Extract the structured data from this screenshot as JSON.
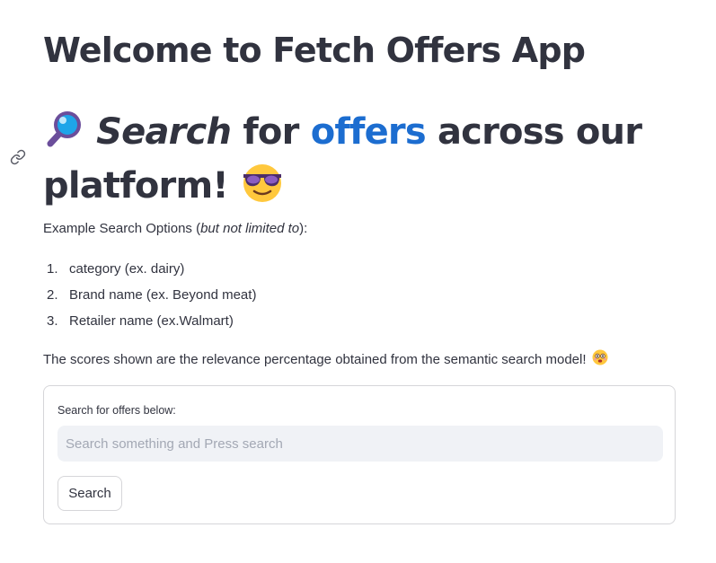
{
  "app_title": "Welcome to Fetch Offers App",
  "headline": {
    "word_search": "Search",
    "word_for": "for",
    "word_offers": "offers",
    "rest_line": "across our",
    "line2": "platform!",
    "accent_color": "#1c6dd0"
  },
  "intro": {
    "prefix": "Example Search Options (",
    "emphasis": "but not limited to",
    "suffix": "):"
  },
  "options": [
    {
      "num": "1.",
      "label": "category (ex. dairy)"
    },
    {
      "num": "2.",
      "label": "Brand name (ex. Beyond meat)"
    },
    {
      "num": "3.",
      "label": "Retailer name (ex.Walmart)"
    }
  ],
  "scores_note": "The scores shown are the relevance percentage obtained from the semantic search model!",
  "form": {
    "label": "Search for offers below:",
    "placeholder": "Search something and Press search",
    "button": "Search"
  },
  "icons": [
    "link-icon",
    "magnifying-glass-icon",
    "sunglasses-face-icon",
    "flushed-face-icon"
  ]
}
